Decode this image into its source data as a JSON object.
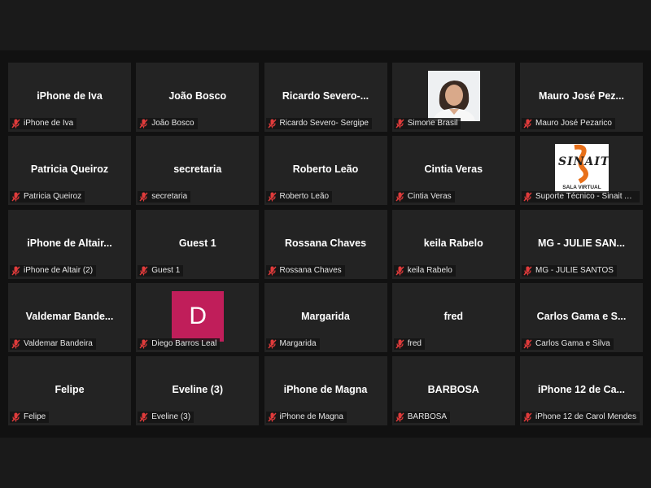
{
  "colors": {
    "tile_bg": "#232323",
    "stage_bg": "#111111",
    "muted_icon": "#e03b3b",
    "avatar_bg": "#c01e5a"
  },
  "participants": [
    {
      "name": "iPhone de Iva",
      "label": "iPhone de Iva"
    },
    {
      "name": "João Bosco",
      "label": "João Bosco"
    },
    {
      "name": "Ricardo  Severo-...",
      "label": "Ricardo Severo- Sergipe"
    },
    {
      "name": "",
      "label": "Simone Brasil",
      "media": "photo"
    },
    {
      "name": "Mauro José Pez...",
      "label": "Mauro José Pezarico"
    },
    {
      "name": "Patricia Queiroz",
      "label": "Patricia Queiroz"
    },
    {
      "name": "secretaria",
      "label": "secretaria"
    },
    {
      "name": "Roberto Leão",
      "label": "Roberto Leão"
    },
    {
      "name": "Cintia Veras",
      "label": "Cintia Veras"
    },
    {
      "name": "",
      "label": "Suporte Técnico - Sinait AFT",
      "media": "logo",
      "logo_text": "SINAIT",
      "logo_sub": "SALA VIRTUAL"
    },
    {
      "name": "iPhone  de  Altair...",
      "label": "iPhone de Altair (2)"
    },
    {
      "name": "Guest 1",
      "label": "Guest 1"
    },
    {
      "name": "Rossana Chaves",
      "label": "Rossana Chaves"
    },
    {
      "name": "keila Rabelo",
      "label": "keila Rabelo"
    },
    {
      "name": "MG - JULIE SAN...",
      "label": "MG - JULIE SANTOS"
    },
    {
      "name": "Valdemar  Bande...",
      "label": "Valdemar Bandeira"
    },
    {
      "name": "",
      "label": "Diego Barros Leal",
      "media": "avatar",
      "avatar_letter": "D"
    },
    {
      "name": "Margarida",
      "label": "Margarida"
    },
    {
      "name": "fred",
      "label": "fred"
    },
    {
      "name": "Carlos Gama e S...",
      "label": "Carlos Gama e Silva"
    },
    {
      "name": "Felipe",
      "label": "Felipe"
    },
    {
      "name": "Eveline (3)",
      "label": "Eveline (3)"
    },
    {
      "name": "iPhone de Magna",
      "label": "iPhone de Magna"
    },
    {
      "name": "BARBOSA",
      "label": "BARBOSA"
    },
    {
      "name": "iPhone  12  de  Ca...",
      "label": "iPhone 12 de Carol Mendes"
    }
  ]
}
